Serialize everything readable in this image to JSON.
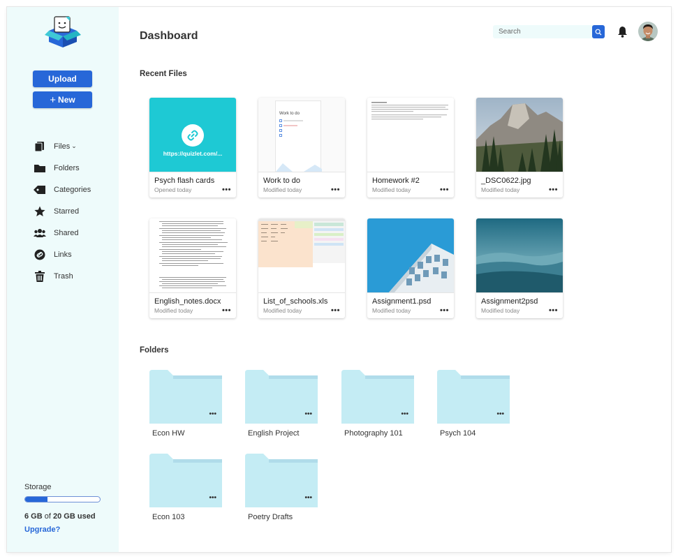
{
  "header": {
    "title": "Dashboard"
  },
  "search": {
    "placeholder": "Search"
  },
  "sidebar": {
    "upload_label": "Upload",
    "new_label": "New",
    "nav": [
      {
        "label": "Files",
        "icon": "files-icon"
      },
      {
        "label": "Folders",
        "icon": "folder-icon"
      },
      {
        "label": "Categories",
        "icon": "tag-icon"
      },
      {
        "label": "Starred",
        "icon": "star-icon"
      },
      {
        "label": "Shared",
        "icon": "people-icon"
      },
      {
        "label": "Links",
        "icon": "link-icon"
      },
      {
        "label": "Trash",
        "icon": "trash-icon"
      }
    ]
  },
  "storage": {
    "title": "Storage",
    "used": "6 GB",
    "of": "of",
    "total": "20 GB",
    "suffix": "used",
    "fraction_used": 0.3,
    "upgrade_label": "Upgrade?"
  },
  "recent": {
    "title": "Recent Files",
    "files": [
      {
        "name": "Psych flash cards",
        "meta": "Opened today",
        "thumb_text": "https://quizlet.com/..."
      },
      {
        "name": "Work to do",
        "meta": "Modified today",
        "thumb_text": "Work to do"
      },
      {
        "name": "Homework #2",
        "meta": "Modified today"
      },
      {
        "name": "_DSC0622.jpg",
        "meta": "Modified today"
      },
      {
        "name": "English_notes.docx",
        "meta": "Modified today"
      },
      {
        "name": "List_of_schools.xls",
        "meta": "Modified today"
      },
      {
        "name": "Assignment1.psd",
        "meta": "Modified today"
      },
      {
        "name": "Assignment2psd",
        "meta": "Modified today"
      }
    ]
  },
  "folders": {
    "title": "Folders",
    "items": [
      {
        "name": "Econ HW"
      },
      {
        "name": "English Project"
      },
      {
        "name": "Photography 101"
      },
      {
        "name": "Psych 104"
      },
      {
        "name": "Econ 103"
      },
      {
        "name": "Poetry Drafts"
      }
    ]
  },
  "colors": {
    "accent": "#2767d8",
    "sidebar_bg": "#eefbfb",
    "folder": "#c4ecf4",
    "folder_tab": "#b0dcea",
    "quizlet": "#1ec9d4"
  }
}
